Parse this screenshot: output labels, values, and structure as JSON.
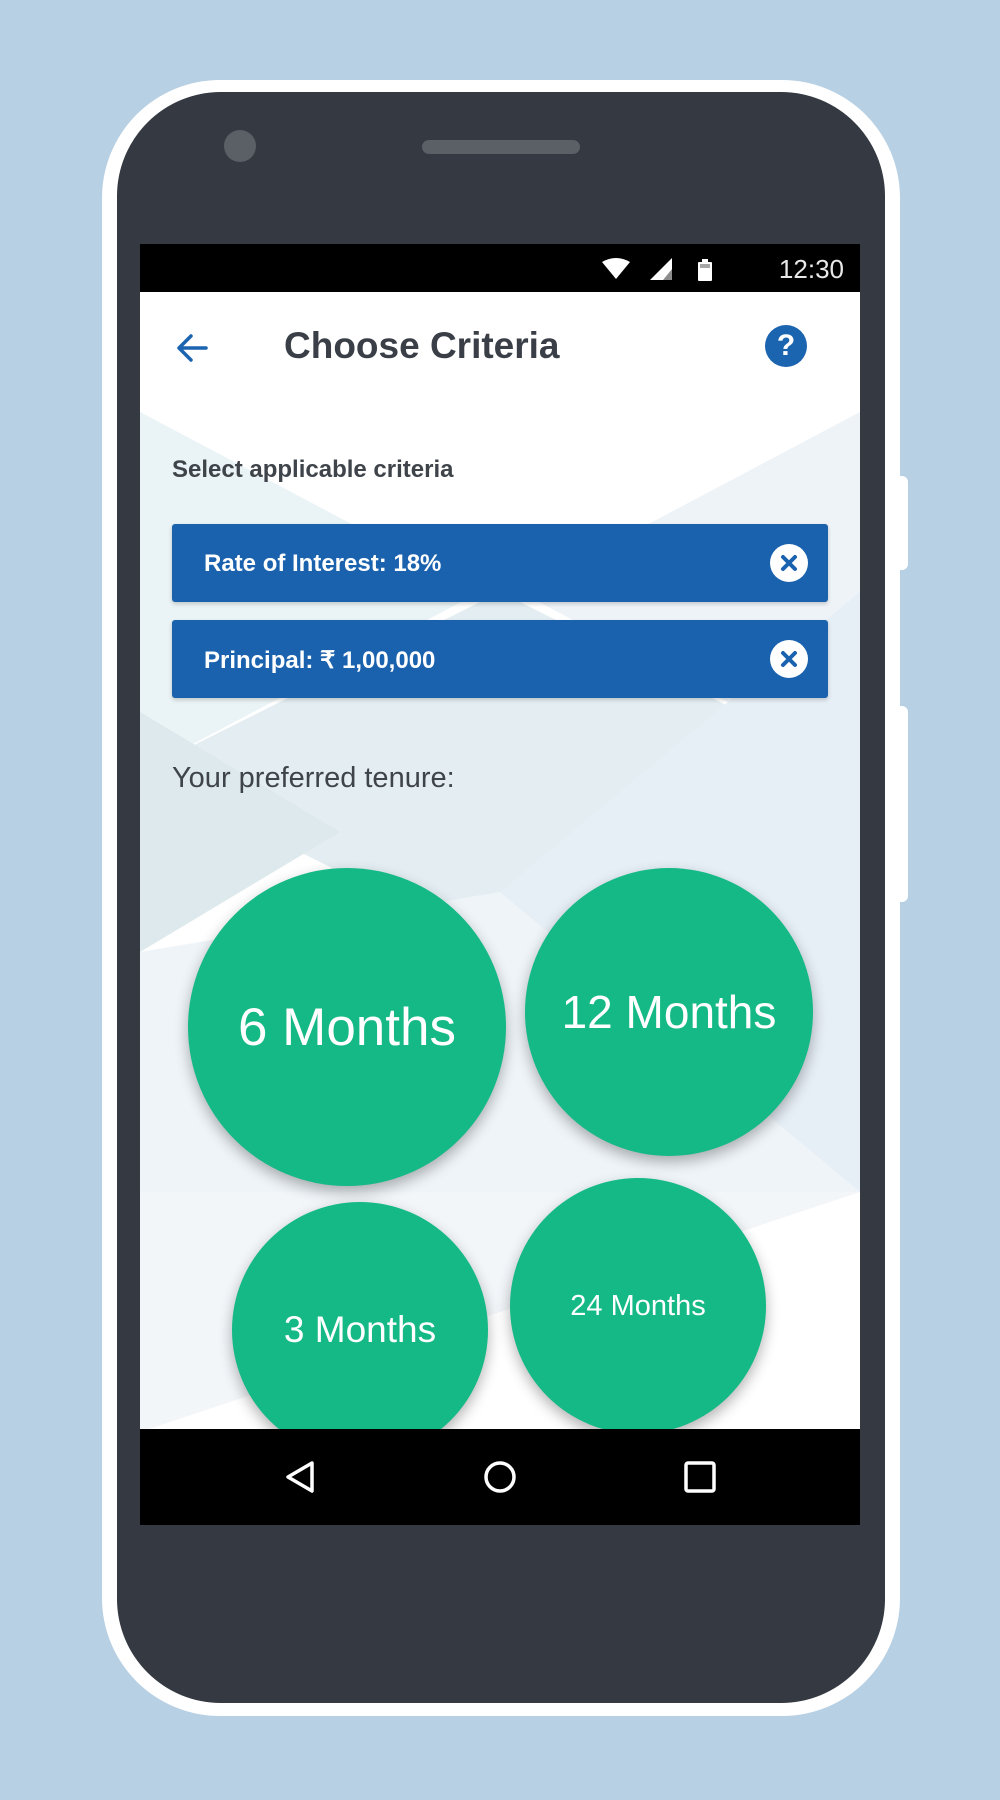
{
  "status_bar": {
    "time": "12:30"
  },
  "header": {
    "title": "Choose Criteria"
  },
  "criteria": {
    "label": "Select applicable criteria",
    "chips": [
      {
        "label": "Rate of Interest: 18%"
      },
      {
        "label": "Principal: ₹ 1,00,000"
      }
    ]
  },
  "tenure": {
    "label": "Your preferred tenure:",
    "options": [
      {
        "label": "6 Months"
      },
      {
        "label": "12 Months"
      },
      {
        "label": "3 Months"
      },
      {
        "label": "24 Months"
      }
    ]
  },
  "colors": {
    "accent_blue": "#1b62ae",
    "bubble_green": "#15b985",
    "frame_dark": "#343942",
    "background": "#b8d0e3"
  },
  "icons": {
    "back": "arrow-left-icon",
    "help": "question-mark-icon",
    "remove": "close-circle-icon",
    "nav": [
      "triangle-back-icon",
      "circle-home-icon",
      "square-recents-icon"
    ]
  }
}
